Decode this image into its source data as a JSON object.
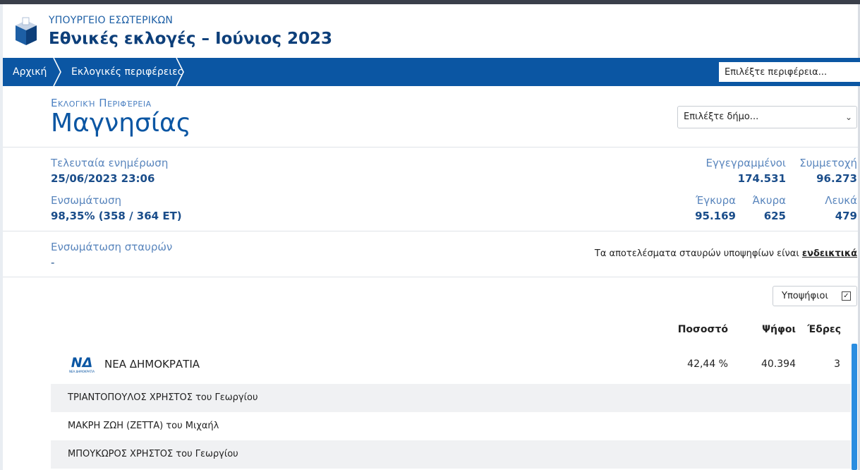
{
  "header": {
    "ministry": "ΥΠΟΥΡΓΕΙΟ ΕΣΩΤΕΡΙΚΩΝ",
    "title": "Εθνικές εκλογές – Ιούνιος 2023"
  },
  "nav": {
    "crumbs": [
      "Αρχική",
      "Εκλογικές περιφέρειες"
    ],
    "search_placeholder": "Επιλέξτε περιφέρεια..."
  },
  "region": {
    "label": "Εκλογική Περιφέρεια",
    "name": "Μαγνησίας",
    "municipality_select": "Επιλέξτε δήμο..."
  },
  "stats": {
    "last_update_label": "Τελευταία ενημέρωση",
    "last_update_value": "25/06/2023 23:06",
    "integration_label": "Ενσωμάτωση",
    "integration_value": "98,35% (358 / 364 ΕΤ)",
    "registered_label": "Εγγεγραμμένοι",
    "registered_value": "174.531",
    "turnout_label": "Συμμετοχή",
    "turnout_value": "96.273",
    "valid_label": "Έγκυρα",
    "valid_value": "95.169",
    "invalid_label": "Άκυρα",
    "invalid_value": "625",
    "blank_label": "Λευκά",
    "blank_value": "479"
  },
  "preferences": {
    "label": "Ενσωμάτωση σταυρών",
    "value": "-",
    "disclaimer_prefix": "Τα αποτελέσματα σταυρών υποψηφίων είναι ",
    "disclaimer_link": "ενδεικτικά"
  },
  "toggle": {
    "label": "Υποψήφιοι",
    "checked": "☑"
  },
  "table": {
    "headers": {
      "percent": "Ποσοστό",
      "votes": "Ψήφοι",
      "seats": "Έδρες"
    },
    "party": {
      "logo_text": "ΝΔ",
      "logo_subtext": "ΝΕΑ ΔΗΜΟΚΡΑΤΙΑ",
      "name": "ΝΕΑ ΔΗΜΟΚΡΑΤΙΑ",
      "percent": "42,44 %",
      "votes": "40.394",
      "seats": "3"
    },
    "candidates": [
      "ΤΡΙΑΝΤΟΠΟΥΛΟΣ ΧΡΗΣΤΟΣ του Γεωργίου",
      "ΜΑΚΡΗ ΖΩΗ (ΖΕΤΤΑ) του Μιχαήλ",
      "ΜΠΟΥΚΩΡΟΣ ΧΡΗΣΤΟΣ του Γεωργίου"
    ]
  },
  "colors": {
    "nav": "#0b56a3",
    "accent": "#1a4d8a",
    "scrollbar": "#2a8de0"
  }
}
